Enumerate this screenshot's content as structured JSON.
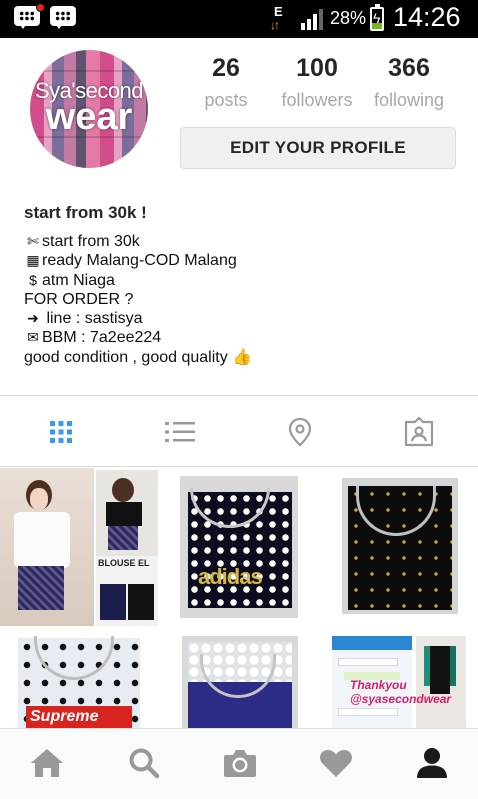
{
  "status_bar": {
    "network_type": "E",
    "battery_percent": "28%",
    "time": "14:26",
    "icons": [
      "bbm-icon",
      "bbm-icon",
      "data-transfer-icon",
      "signal-icon",
      "battery-charging-icon"
    ]
  },
  "profile": {
    "avatar_text_line1": "Sya'second",
    "avatar_text_line2": "wear",
    "stats": [
      {
        "value": "26",
        "label": "posts"
      },
      {
        "value": "100",
        "label": "followers"
      },
      {
        "value": "366",
        "label": "following"
      }
    ],
    "edit_button_label": "EDIT YOUR PROFILE"
  },
  "bio": {
    "name": "start from 30k !",
    "lines": [
      {
        "icon": "✄",
        "text": "start from 30k"
      },
      {
        "icon": "▦",
        "text": "ready Malang-COD Malang"
      },
      {
        "icon": "$",
        "text": "atm Niaga"
      },
      {
        "icon": "",
        "text": "FOR ORDER ?"
      },
      {
        "icon": "➜",
        "text": " line : sastisya"
      },
      {
        "icon": "✉",
        "text": "BBM : 7a2ee224"
      },
      {
        "icon": "",
        "text": "good condition , good quality 👍"
      }
    ]
  },
  "view_tabs": [
    "grid-view-icon",
    "list-view-icon",
    "location-pin-icon",
    "tagged-photos-icon"
  ],
  "grid_posts": [
    {
      "id": "post-1",
      "caption_visible": "BLOUSE EL"
    },
    {
      "id": "post-2",
      "caption_visible": "adidas"
    },
    {
      "id": "post-3",
      "caption_visible": ""
    },
    {
      "id": "post-4",
      "caption_visible": "Supreme"
    },
    {
      "id": "post-5",
      "caption_visible": ""
    },
    {
      "id": "post-6",
      "caption_visible": "Thankyou @syasecondwear"
    }
  ],
  "bottom_nav": [
    "home-icon",
    "search-icon",
    "camera-icon",
    "heart-icon",
    "profile-icon"
  ],
  "colors": {
    "accent_blue": "#3897f0",
    "icon_gray": "#999999",
    "stat_label_gray": "#a8a8a8",
    "active_dark": "#262626"
  }
}
